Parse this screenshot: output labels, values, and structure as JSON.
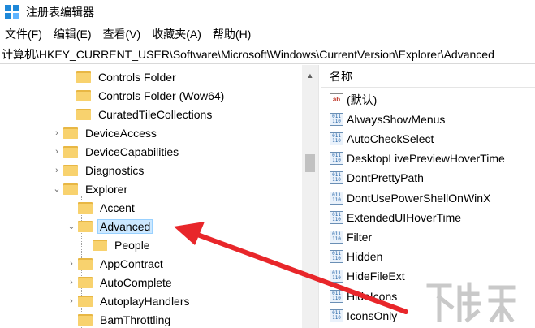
{
  "window": {
    "title": "注册表编辑器"
  },
  "menu": [
    "文件(F)",
    "编辑(E)",
    "查看(V)",
    "收藏夹(A)",
    "帮助(H)"
  ],
  "address": "计算机\\HKEY_CURRENT_USER\\Software\\Microsoft\\Windows\\CurrentVersion\\Explorer\\Advanced",
  "tree": [
    {
      "label": "Controls Folder",
      "expander": ""
    },
    {
      "label": "Controls Folder (Wow64)",
      "expander": ""
    },
    {
      "label": "CuratedTileCollections",
      "expander": ""
    },
    {
      "label": "DeviceAccess",
      "expander": "›"
    },
    {
      "label": "DeviceCapabilities",
      "expander": "›"
    },
    {
      "label": "Diagnostics",
      "expander": "›"
    },
    {
      "label": "Explorer",
      "expander": "⌄"
    },
    {
      "label": "Accent",
      "expander": ""
    },
    {
      "label": "Advanced",
      "expander": "⌄",
      "selected": true
    },
    {
      "label": "People",
      "expander": ""
    },
    {
      "label": "AppContract",
      "expander": "›"
    },
    {
      "label": "AutoComplete",
      "expander": "›"
    },
    {
      "label": "AutoplayHandlers",
      "expander": "›"
    },
    {
      "label": "BamThrottling",
      "expander": ""
    }
  ],
  "values_header": "名称",
  "values": [
    {
      "name": "(默认)",
      "icon": "string-value-icon"
    },
    {
      "name": "AlwaysShowMenus",
      "icon": "binary-value-icon"
    },
    {
      "name": "AutoCheckSelect",
      "icon": "binary-value-icon"
    },
    {
      "name": "DesktopLivePreviewHoverTime",
      "icon": "binary-value-icon"
    },
    {
      "name": "DontPrettyPath",
      "icon": "binary-value-icon"
    },
    {
      "name": "DontUsePowerShellOnWinX",
      "icon": "binary-value-icon"
    },
    {
      "name": "ExtendedUIHoverTime",
      "icon": "binary-value-icon"
    },
    {
      "name": "Filter",
      "icon": "binary-value-icon"
    },
    {
      "name": "Hidden",
      "icon": "binary-value-icon"
    },
    {
      "name": "HideFileExt",
      "icon": "binary-value-icon"
    },
    {
      "name": "HideIcons",
      "icon": "binary-value-icon"
    },
    {
      "name": "IconsOnly",
      "icon": "binary-value-icon"
    }
  ],
  "colors": {
    "arrow": "#e8262a",
    "selection": "#cce8ff",
    "folder": "#f8d26e"
  }
}
